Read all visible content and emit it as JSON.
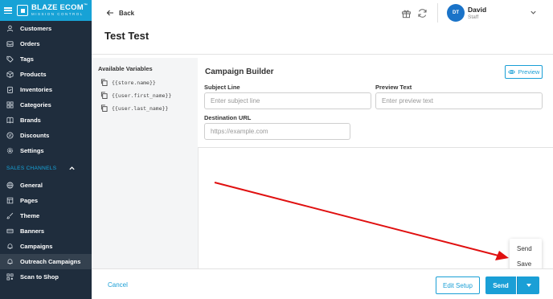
{
  "brand": {
    "title": "BLAZE ECOM",
    "tm": "™",
    "subtitle": "MISSION CONTROL"
  },
  "sidebar": {
    "items_top": [
      {
        "label": "Customers",
        "icon": "user-icon"
      },
      {
        "label": "Orders",
        "icon": "inbox-icon"
      },
      {
        "label": "Tags",
        "icon": "tag-icon"
      },
      {
        "label": "Products",
        "icon": "box-icon"
      },
      {
        "label": "Inventories",
        "icon": "clipboard-icon"
      },
      {
        "label": "Categories",
        "icon": "grid-icon"
      },
      {
        "label": "Brands",
        "icon": "book-icon"
      },
      {
        "label": "Discounts",
        "icon": "discount-icon"
      },
      {
        "label": "Settings",
        "icon": "gear-icon"
      }
    ],
    "section_label": "SALES CHANNELS",
    "items_channels": [
      {
        "label": "General",
        "icon": "globe-icon"
      },
      {
        "label": "Pages",
        "icon": "page-icon"
      },
      {
        "label": "Theme",
        "icon": "brush-icon"
      },
      {
        "label": "Banners",
        "icon": "banner-icon"
      },
      {
        "label": "Campaigns",
        "icon": "bell-icon"
      },
      {
        "label": "Outreach Campaigns",
        "icon": "bell-icon"
      },
      {
        "label": "Scan to Shop",
        "icon": "qr-icon"
      }
    ],
    "active": "Outreach Campaigns"
  },
  "header": {
    "back_label": "Back",
    "page_title": "Test Test",
    "user": {
      "initials": "DT",
      "name": "David",
      "role": "Staff"
    }
  },
  "variables": {
    "title": "Available Variables",
    "items": [
      "{{store.name}}",
      "{{user.first_name}}",
      "{{user.last_name}}"
    ]
  },
  "builder": {
    "title": "Campaign Builder",
    "preview_label": "Preview",
    "subject": {
      "label": "Subject Line",
      "placeholder": "Enter subject line",
      "value": ""
    },
    "preview_text": {
      "label": "Preview Text",
      "placeholder": "Enter preview text",
      "value": ""
    },
    "destination": {
      "label": "Destination URL",
      "placeholder": "https://example.com",
      "value": ""
    }
  },
  "send_menu": {
    "items": [
      "Send",
      "Save"
    ]
  },
  "footer": {
    "cancel_label": "Cancel",
    "edit_setup_label": "Edit Setup",
    "send_label": "Send"
  },
  "colors": {
    "sidebar_bg": "#1f2d3d",
    "brand_bg": "#17a2d6",
    "accent": "#1a9fd6",
    "annotation_arrow": "#e01010"
  }
}
